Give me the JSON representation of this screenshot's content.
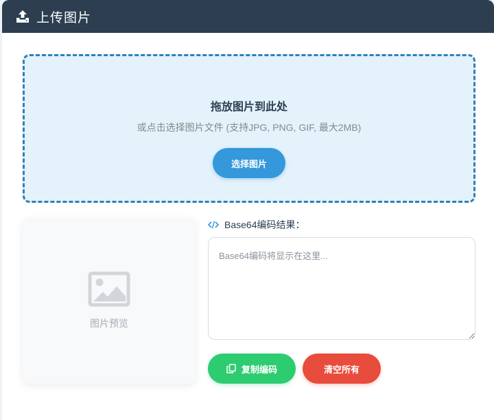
{
  "header": {
    "title": "上传图片",
    "icon": "upload-icon"
  },
  "dropzone": {
    "title": "拖放图片到此处",
    "subtitle": "或点击选择图片文件 (支持JPG, PNG, GIF, 最大2MB)",
    "button_label": "选择图片"
  },
  "preview": {
    "placeholder_text": "图片预览",
    "icon": "image-icon"
  },
  "result": {
    "label": "Base64编码结果：",
    "icon": "code-icon",
    "value": "",
    "placeholder": "Base64编码将显示在这里..."
  },
  "actions": {
    "copy_label": "复制编码",
    "copy_icon": "copy-icon",
    "clear_label": "清空所有"
  },
  "colors": {
    "header_bg": "#2c3e50",
    "primary": "#3498db",
    "dropzone_border": "#2f7fb5",
    "dropzone_bg": "#e4f2fc",
    "success": "#2ecc71",
    "danger": "#e74c3c"
  }
}
